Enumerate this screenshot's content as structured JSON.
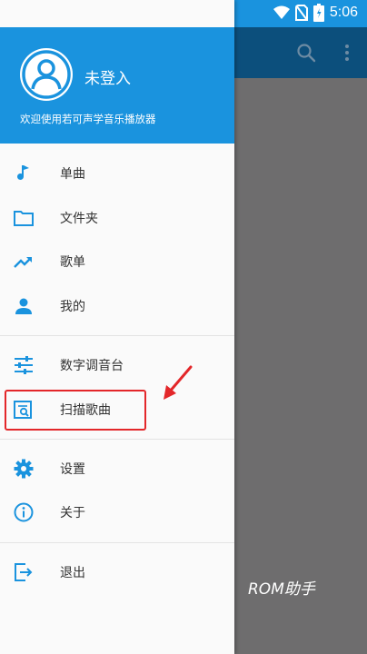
{
  "status_bar": {
    "time": "5:06"
  },
  "drawer": {
    "user_name": "未登入",
    "welcome": "欢迎使用若可声学音乐播放器",
    "items": [
      {
        "label": "单曲",
        "icon": "music-note-icon"
      },
      {
        "label": "文件夹",
        "icon": "folder-icon"
      },
      {
        "label": "歌单",
        "icon": "trending-up-icon"
      },
      {
        "label": "我的",
        "icon": "person-icon"
      },
      {
        "label": "数字调音台",
        "icon": "equalizer-icon"
      },
      {
        "label": "扫描歌曲",
        "icon": "scan-icon"
      },
      {
        "label": "设置",
        "icon": "gear-icon"
      },
      {
        "label": "关于",
        "icon": "info-icon"
      },
      {
        "label": "退出",
        "icon": "exit-icon"
      }
    ]
  },
  "watermark": "ROM助手",
  "colors": {
    "primary": "#1a93de",
    "toolbar_dark": "#0c4f7c",
    "highlight": "#e3272a",
    "scrim": "#6e6d6e"
  }
}
